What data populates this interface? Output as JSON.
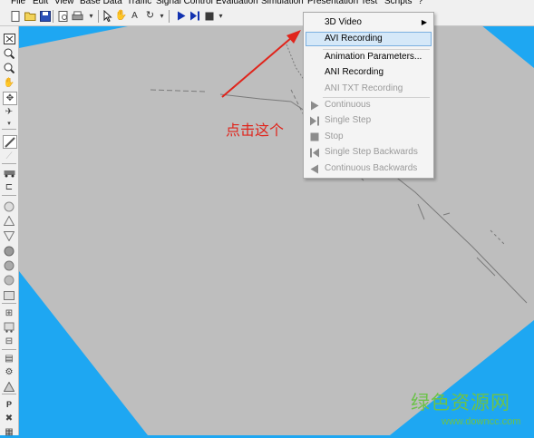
{
  "menubar": {
    "items": [
      "File",
      "Edit",
      "View",
      "Base Data",
      "Traffic",
      "Signal Control",
      "Evaluation",
      "Simulation",
      "Presentation",
      "Test",
      "Scripts",
      "?"
    ]
  },
  "context_menu": {
    "items": [
      {
        "label": "3D Video",
        "has_submenu": true,
        "enabled": true
      },
      {
        "label": "AVI Recording",
        "enabled": true,
        "highlighted": true
      },
      {
        "label": "Animation Parameters...",
        "enabled": true
      },
      {
        "label": "ANI Recording",
        "enabled": true
      },
      {
        "label": "ANI TXT Recording",
        "enabled": false
      },
      {
        "label": "Continuous",
        "enabled": false,
        "icon": "play-icon"
      },
      {
        "label": "Single Step",
        "enabled": false,
        "icon": "step-forward-icon"
      },
      {
        "label": "Stop",
        "enabled": false,
        "icon": "stop-icon"
      },
      {
        "label": "Single Step Backwards",
        "enabled": false,
        "icon": "step-backward-icon"
      },
      {
        "label": "Continuous Backwards",
        "enabled": false,
        "icon": "play-backward-icon"
      }
    ]
  },
  "annotation": {
    "text": "点击这个",
    "color": "#e0241b"
  },
  "watermark": {
    "main": "绿色资源网",
    "url": "www.downcc.com",
    "color": "#6cc24a"
  },
  "colors": {
    "background": "#1ea7f2",
    "ground_plane": "#bebebe",
    "menu_highlight": "#d5e8f8"
  }
}
